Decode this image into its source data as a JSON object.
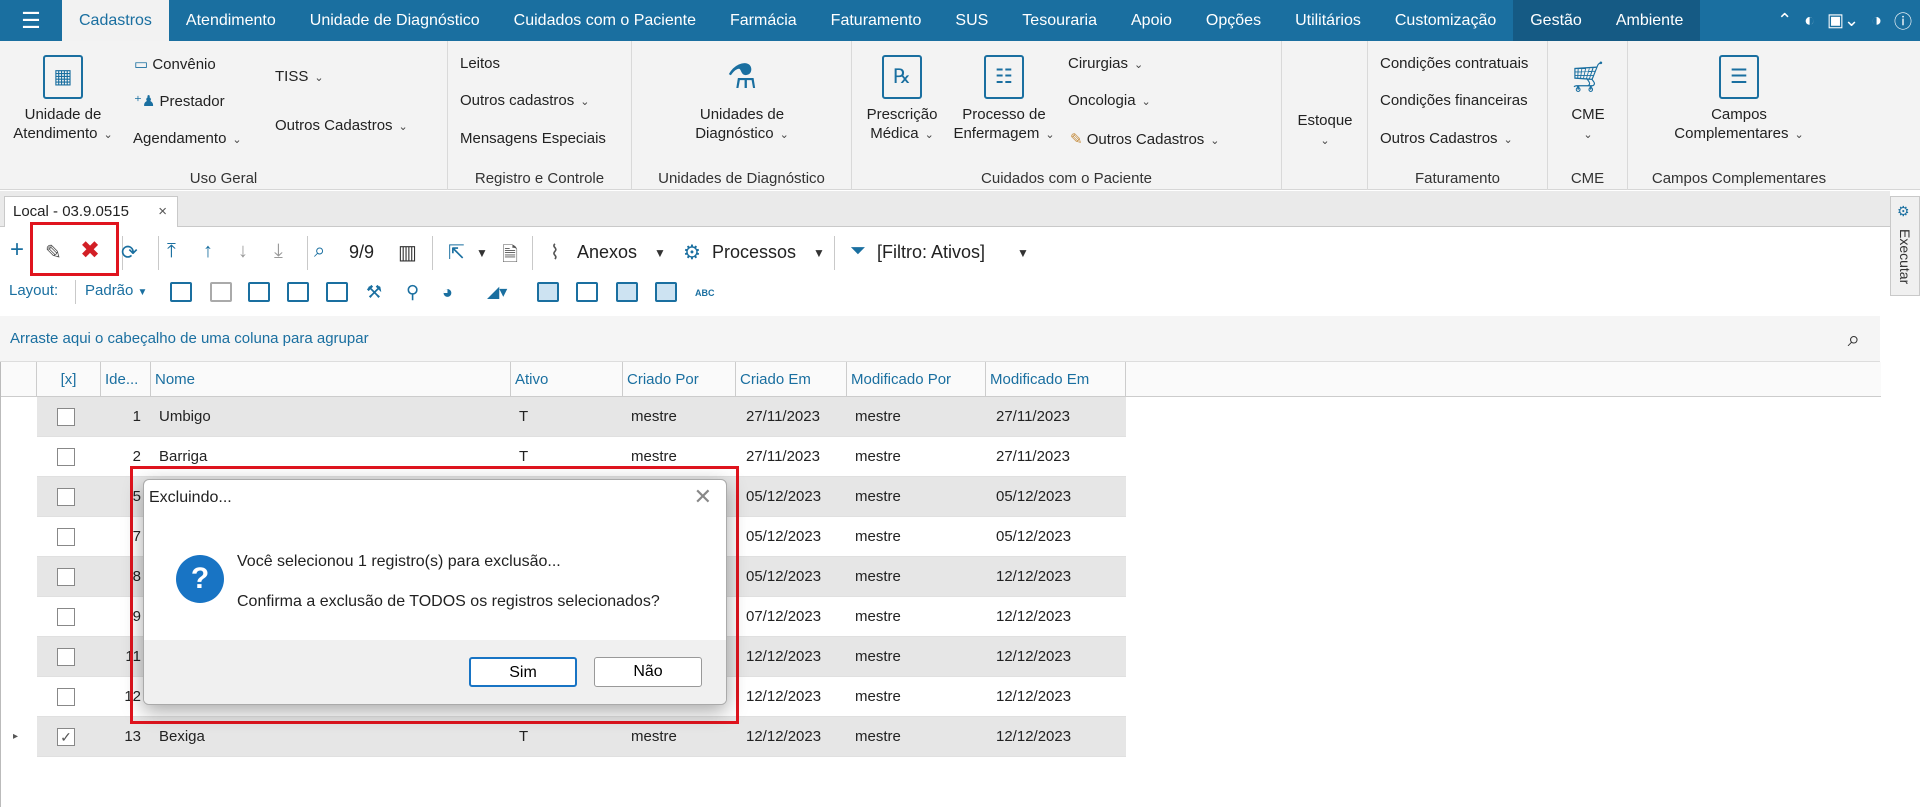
{
  "menubar": {
    "items": [
      "Cadastros",
      "Atendimento",
      "Unidade de Diagnóstico",
      "Cuidados com o Paciente",
      "Farmácia",
      "Faturamento",
      "SUS",
      "Tesouraria",
      "Apoio",
      "Opções",
      "Utilitários",
      "Customização",
      "Gestão",
      "Ambiente"
    ],
    "active": "Cadastros"
  },
  "ribbon": {
    "uso_geral": {
      "label": "Uso Geral",
      "unidade_atendimento": "Unidade de\nAtendimento",
      "convenio": "Convênio",
      "prestador": "Prestador",
      "agendamento": "Agendamento",
      "tiss": "TISS",
      "outros_cadastros": "Outros Cadastros"
    },
    "registro": {
      "label": "Registro e Controle",
      "leitos": "Leitos",
      "outros_cadastros": "Outros cadastros",
      "mensagens": "Mensagens Especiais"
    },
    "unidades_diag": {
      "label": "Unidades de Diagnóstico",
      "btn": "Unidades de\nDiagnóstico"
    },
    "cuidados": {
      "label": "Cuidados com o Paciente",
      "prescricao": "Prescrição\nMédica",
      "processo": "Processo de\nEnfermagem",
      "cirurgias": "Cirurgias",
      "oncologia": "Oncologia",
      "outros_cadastros": "Outros Cadastros"
    },
    "estoque": {
      "btn": "Estoque"
    },
    "faturamento": {
      "label": "Faturamento",
      "cond_contratuais": "Condições contratuais",
      "cond_financeiras": "Condições financeiras",
      "outros_cadastros": "Outros Cadastros"
    },
    "cme": {
      "label": "CME",
      "btn": "CME"
    },
    "campos": {
      "label": "Campos Complementares",
      "btn": "Campos\nComplementares"
    }
  },
  "doc_tab": {
    "label": "Local - 03.9.0515",
    "close": "×"
  },
  "side_panel": {
    "label": "Executar"
  },
  "toolbar": {
    "count": "9/9",
    "anexos": "Anexos",
    "processos": "Processos",
    "filtro": "[Filtro: Ativos]"
  },
  "layout_bar": {
    "label": "Layout:",
    "value": "Padrão",
    "abc": "ABC"
  },
  "group_bar": {
    "text": "Arraste aqui o cabeçalho de uma coluna para agrupar"
  },
  "grid": {
    "columns": [
      "[x]",
      "Ide...",
      "Nome",
      "Ativo",
      "Criado Por",
      "Criado Em",
      "Modificado Por",
      "Modificado Em"
    ],
    "rows": [
      {
        "checked": false,
        "id": "1",
        "nome": "Umbigo",
        "ativo": "T",
        "criado_por": "mestre",
        "criado_em": "27/11/2023",
        "mod_por": "mestre",
        "mod_em": "27/11/2023"
      },
      {
        "checked": false,
        "id": "2",
        "nome": "Barriga",
        "ativo": "T",
        "criado_por": "mestre",
        "criado_em": "27/11/2023",
        "mod_por": "mestre",
        "mod_em": "27/11/2023"
      },
      {
        "checked": false,
        "id": "5",
        "nome": "",
        "ativo": "",
        "criado_por": "",
        "criado_em": "05/12/2023",
        "mod_por": "mestre",
        "mod_em": "05/12/2023"
      },
      {
        "checked": false,
        "id": "7",
        "nome": "",
        "ativo": "",
        "criado_por": "",
        "criado_em": "05/12/2023",
        "mod_por": "mestre",
        "mod_em": "05/12/2023"
      },
      {
        "checked": false,
        "id": "8",
        "nome": "",
        "ativo": "",
        "criado_por": "",
        "criado_em": "05/12/2023",
        "mod_por": "mestre",
        "mod_em": "12/12/2023"
      },
      {
        "checked": false,
        "id": "9",
        "nome": "",
        "ativo": "",
        "criado_por": "",
        "criado_em": "07/12/2023",
        "mod_por": "mestre",
        "mod_em": "12/12/2023"
      },
      {
        "checked": false,
        "id": "11",
        "nome": "",
        "ativo": "",
        "criado_por": "",
        "criado_em": "12/12/2023",
        "mod_por": "mestre",
        "mod_em": "12/12/2023"
      },
      {
        "checked": false,
        "id": "12",
        "nome": "",
        "ativo": "",
        "criado_por": "",
        "criado_em": "12/12/2023",
        "mod_por": "mestre",
        "mod_em": "12/12/2023"
      },
      {
        "checked": true,
        "id": "13",
        "nome": "Bexiga",
        "ativo": "T",
        "criado_por": "mestre",
        "criado_em": "12/12/2023",
        "mod_por": "mestre",
        "mod_em": "12/12/2023"
      }
    ]
  },
  "dialog": {
    "title": "Excluindo...",
    "line1": "Você selecionou 1 registro(s) para exclusão...",
    "line2": "Confirma a exclusão de TODOS os registros selecionados?",
    "yes": "Sim",
    "no": "Não",
    "question_mark": "?"
  },
  "colors": {
    "brand": "#1a6fa0",
    "highlight": "#e0141e"
  }
}
